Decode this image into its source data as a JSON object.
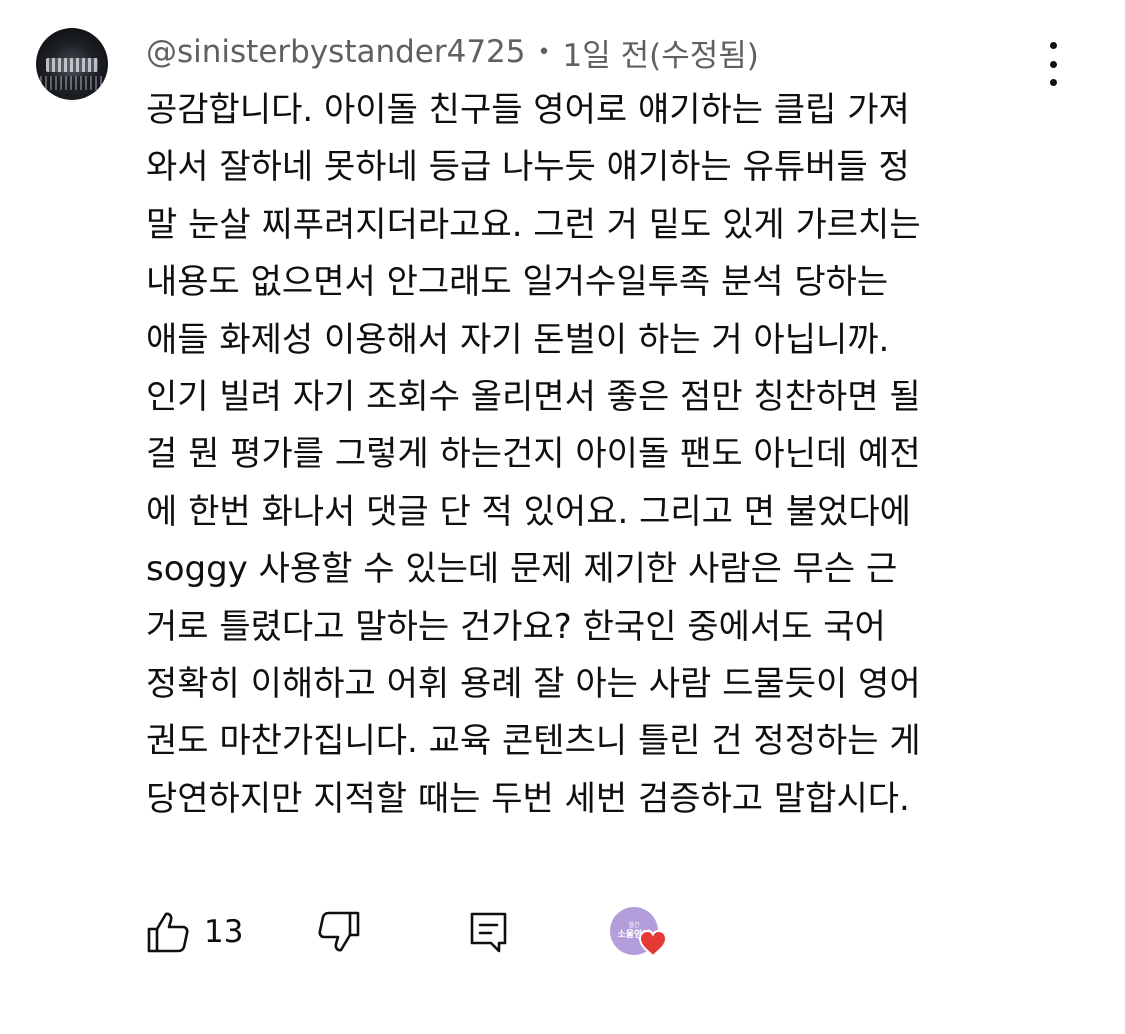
{
  "comment": {
    "author": "@sinisterbystander4725",
    "separator": "•",
    "time": "1일 전(수정됨)",
    "lines": [
      "공감합니다. 아이돌 친구들 영어로 얘기하는 클립 가져",
      "와서 잘하네 못하네 등급 나누듯 얘기하는 유튜버들 정",
      "말 눈살 찌푸려지더라고요. 그런 거 밑도 있게 가르치는",
      "내용도 없으면서 안그래도 일거수일투족 분석 당하는",
      "애들 화제성 이용해서 자기 돈벌이 하는 거 아닙니까.",
      "인기 빌려 자기 조회수 올리면서 좋은 점만 칭찬하면 될",
      "걸 뭔 평가를 그렇게 하는건지 아이돌 팬도 아닌데 예전",
      "에 한번 화나서 댓글 단 적 있어요. 그리고 면 불었다에",
      "soggy 사용할 수 있는데 문제 제기한 사람은 무슨 근",
      "거로 틀렸다고 말하는 건가요? 한국인 중에서도 국어",
      "정확히 이해하고 어휘 용례 잘 아는 사람 드물듯이 영어",
      "권도 마찬가집니다. 교육 콘텐츠니 틀린 건 정정하는 게",
      "당연하지만 지적할 때는 두번 세번 검증하고 말합시다."
    ]
  },
  "actions": {
    "like_count": "13",
    "like_icon": "thumbs-up-icon",
    "dislike_icon": "thumbs-down-icon",
    "reply_icon": "reply-icon",
    "menu_icon": "more-vertical-icon"
  },
  "creator_heart": {
    "badge_top": "월간",
    "badge_main": "소울영어",
    "heart_color": "#e53935",
    "badge_color": "#b39ddb"
  }
}
